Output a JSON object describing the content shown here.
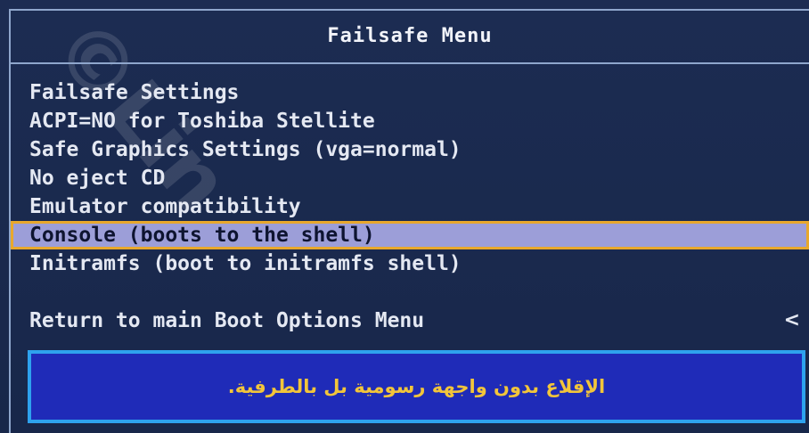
{
  "title": "Failsafe Menu",
  "items": [
    {
      "label": "Failsafe Settings",
      "selected": false
    },
    {
      "label": "ACPI=NO for Toshiba Stellite",
      "selected": false
    },
    {
      "label": "Safe Graphics Settings (vga=normal)",
      "selected": false
    },
    {
      "label": "No eject CD",
      "selected": false
    },
    {
      "label": "Emulator compatibility",
      "selected": false
    },
    {
      "label": "Console (boots to the shell)",
      "selected": true
    },
    {
      "label": "Initramfs (boot to initramfs shell)",
      "selected": false
    }
  ],
  "return_item": {
    "label": "Return to main Boot Options Menu",
    "chevron": "<"
  },
  "hint": "الإقلاع بدون واجهة رسومية بل بالطرفية.",
  "watermark": "©Lin",
  "colors": {
    "background": "#1c2c52",
    "selected_bg": "#9c9ed8",
    "selected_border": "#e8a82c",
    "hint_bg": "#1f2bb8",
    "hint_border": "#2ea2ee",
    "hint_text": "#f2c53a"
  }
}
